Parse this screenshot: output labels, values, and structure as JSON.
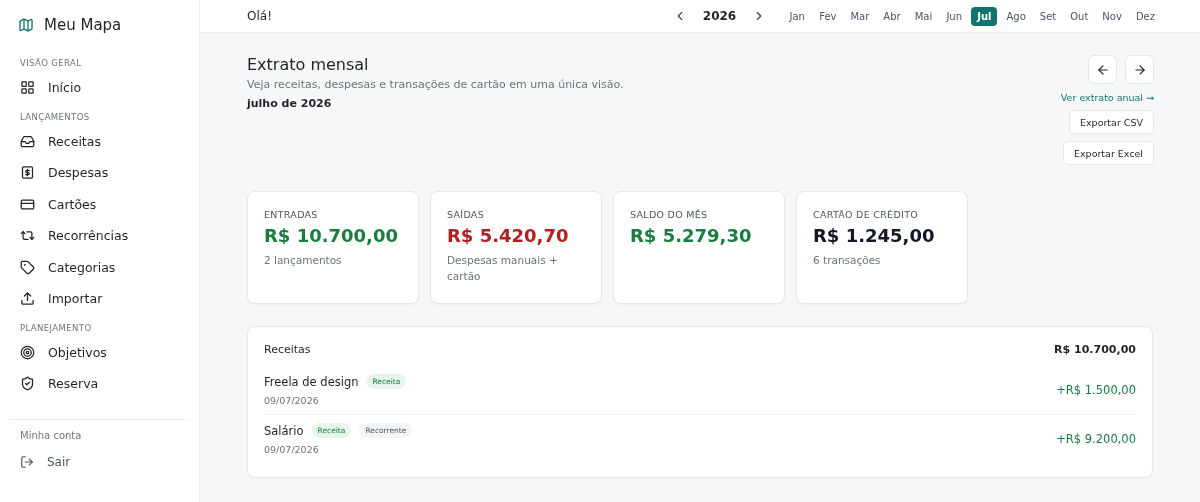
{
  "brand": "Meu Mapa",
  "sidebar": {
    "sections": [
      {
        "heading": "VISÃO GERAL",
        "items": [
          {
            "label": "Início"
          }
        ]
      },
      {
        "heading": "LANÇAMENTOS",
        "items": [
          {
            "label": "Receitas"
          },
          {
            "label": "Despesas"
          },
          {
            "label": "Cartões"
          },
          {
            "label": "Recorrências"
          },
          {
            "label": "Categorias"
          },
          {
            "label": "Importar"
          }
        ]
      },
      {
        "heading": "PLANEJAMENTO",
        "items": [
          {
            "label": "Objetivos"
          },
          {
            "label": "Reserva"
          }
        ]
      }
    ],
    "account_heading": "Minha conta",
    "logout": "Sair"
  },
  "topbar": {
    "greeting": "Olá!",
    "year": "2026",
    "months": [
      {
        "label": "Jan",
        "selected": false
      },
      {
        "label": "Fev",
        "selected": false
      },
      {
        "label": "Mar",
        "selected": false
      },
      {
        "label": "Abr",
        "selected": false
      },
      {
        "label": "Mai",
        "selected": false
      },
      {
        "label": "Jun",
        "selected": false
      },
      {
        "label": "Jul",
        "selected": true
      },
      {
        "label": "Ago",
        "selected": false
      },
      {
        "label": "Set",
        "selected": false
      },
      {
        "label": "Out",
        "selected": false
      },
      {
        "label": "Nov",
        "selected": false
      },
      {
        "label": "Dez",
        "selected": false
      }
    ]
  },
  "header": {
    "title": "Extrato mensal",
    "subtitle": "Veja receitas, despesas e transações de cartão em uma única visão.",
    "period": "julho de 2026",
    "annual_link": "Ver extrato anual →",
    "buttons": [
      "Exportar CSV",
      "Exportar Excel"
    ]
  },
  "summary_cards": [
    {
      "label": "ENTRADAS",
      "value": "R$ 10.700,00",
      "kind": "positive",
      "note": "2 lançamentos"
    },
    {
      "label": "SAÍDAS",
      "value": "R$ 5.420,70",
      "kind": "negative",
      "note": "Despesas manuais + cartão"
    },
    {
      "label": "SALDO DO MÊS",
      "value": "R$ 5.279,30",
      "kind": "positive"
    },
    {
      "label": "CARTÃO DE CRÉDITO",
      "value": "R$ 1.245,00",
      "kind": "neutral",
      "note": "6 transações"
    }
  ],
  "income_section": {
    "title": "Receitas",
    "total": "R$ 10.700,00",
    "rows": [
      {
        "name": "Freela de design",
        "tags": [
          {
            "label": "Receita",
            "kind": "type"
          }
        ],
        "date": "09/07/2026",
        "amount": "+R$ 1.500,00"
      },
      {
        "name": "Salário",
        "tags": [
          {
            "label": "Receita",
            "kind": "type"
          },
          {
            "label": "Recorrente",
            "kind": "status"
          }
        ],
        "date": "09/07/2026",
        "amount": "+R$ 9.200,00"
      }
    ]
  }
}
